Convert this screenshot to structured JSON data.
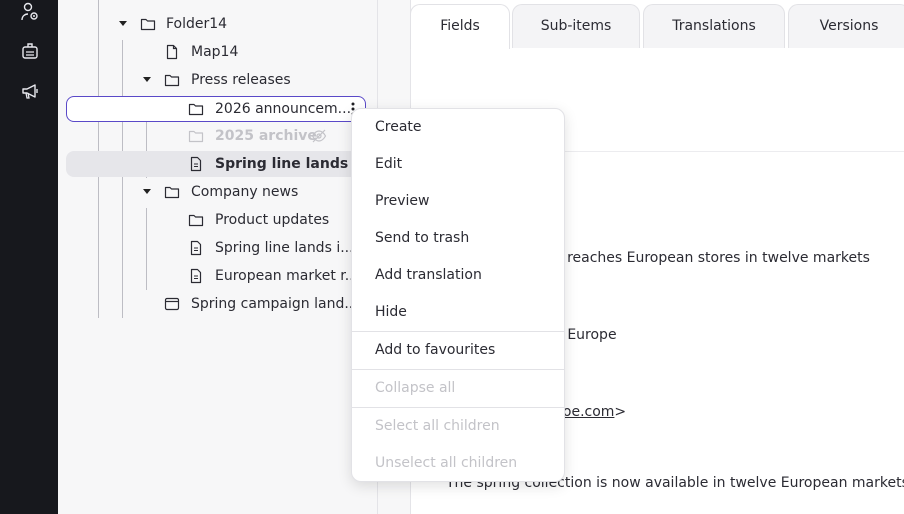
{
  "rail": {
    "icons": [
      "user-settings-icon",
      "briefcase-icon",
      "megaphone-icon"
    ]
  },
  "tree": {
    "items": [
      {
        "label": "Folder14",
        "type": "folder",
        "expanded": true
      },
      {
        "label": "Map14",
        "type": "page"
      },
      {
        "label": "Press releases",
        "type": "folder",
        "expanded": true
      },
      {
        "label": "2026 announcem...",
        "type": "folder",
        "state": "focused"
      },
      {
        "label": "2025 archive",
        "type": "folder",
        "state": "hidden"
      },
      {
        "label": "Spring line lands i...",
        "type": "page",
        "state": "selected"
      },
      {
        "label": "Company news",
        "type": "folder",
        "expanded": true
      },
      {
        "label": "Product updates",
        "type": "folder"
      },
      {
        "label": "Spring line lands i...",
        "type": "page"
      },
      {
        "label": "European market r...",
        "type": "page"
      },
      {
        "label": "Spring campaign land...",
        "type": "template"
      }
    ]
  },
  "tabs": [
    {
      "label": "Fields",
      "active": true
    },
    {
      "label": "Sub-items"
    },
    {
      "label": "Translations"
    },
    {
      "label": "Versions"
    }
  ],
  "fields": {
    "line1": "e reaches European stores in twelve markets",
    "line2": "n Europe",
    "line3_link": "doe.com",
    "line3_suffix": ">",
    "line4": "The spring collection is now available in twelve European markets, wit"
  },
  "context_menu": {
    "items": [
      {
        "label": "Create",
        "enabled": true
      },
      {
        "label": "Edit",
        "enabled": true
      },
      {
        "label": "Preview",
        "enabled": true
      },
      {
        "label": "Send to trash",
        "enabled": true
      },
      {
        "label": "Add translation",
        "enabled": true
      },
      {
        "label": "Hide",
        "enabled": true
      },
      {
        "label": "Add to favourites",
        "enabled": true
      },
      {
        "label": "Collapse all",
        "enabled": false
      },
      {
        "label": "Select all children",
        "enabled": false
      },
      {
        "label": "Unselect all children",
        "enabled": false
      }
    ]
  },
  "colors": {
    "rail": "#17181d",
    "focus_outline": "#5a49c8",
    "selected_row": "#e6e6ea",
    "disabled_text": "#c3c3c8"
  }
}
